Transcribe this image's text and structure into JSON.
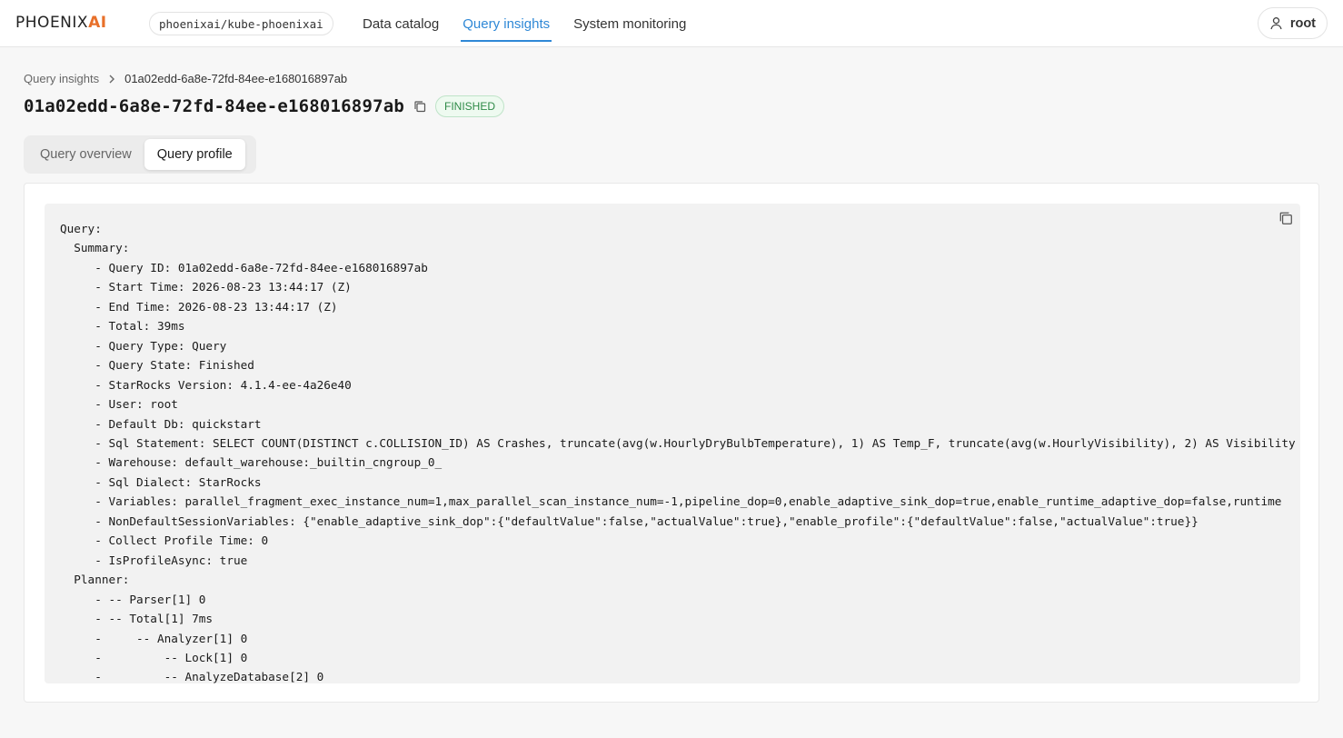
{
  "brand": {
    "logo_main": "PH",
    "logo_o": "O",
    "logo_rest": "ENI",
    "logo_x": "X",
    "logo_ai": "AI"
  },
  "cluster": "phoenixai/kube-phoenixai",
  "nav": {
    "items": [
      {
        "label": "Data catalog"
      },
      {
        "label": "Query insights"
      },
      {
        "label": "System monitoring"
      }
    ],
    "active": "Query insights"
  },
  "user": {
    "name": "root",
    "icon": "user-icon"
  },
  "breadcrumb": {
    "parent": "Query insights",
    "current": "01a02edd-6a8e-72fd-84ee-e168016897ab"
  },
  "title": "01a02edd-6a8e-72fd-84ee-e168016897ab",
  "status": {
    "label": "FINISHED",
    "color": "#2e8a47"
  },
  "tabs": [
    {
      "label": "Query overview"
    },
    {
      "label": "Query profile"
    }
  ],
  "active_tab": "Query profile",
  "profile_lines": [
    "Query:",
    "  Summary:",
    "     - Query ID: 01a02edd-6a8e-72fd-84ee-e168016897ab",
    "     - Start Time: 2026-08-23 13:44:17 (Z)",
    "     - End Time: 2026-08-23 13:44:17 (Z)",
    "     - Total: 39ms",
    "     - Query Type: Query",
    "     - Query State: Finished",
    "     - StarRocks Version: 4.1.4-ee-4a26e40",
    "     - User: root",
    "     - Default Db: quickstart",
    "     - Sql Statement: SELECT COUNT(DISTINCT c.COLLISION_ID) AS Crashes, truncate(avg(w.HourlyDryBulbTemperature), 1) AS Temp_F, truncate(avg(w.HourlyVisibility), 2) AS Visibility",
    "     - Warehouse: default_warehouse:_builtin_cngroup_0_",
    "     - Sql Dialect: StarRocks",
    "     - Variables: parallel_fragment_exec_instance_num=1,max_parallel_scan_instance_num=-1,pipeline_dop=0,enable_adaptive_sink_dop=true,enable_runtime_adaptive_dop=false,runtime",
    "     - NonDefaultSessionVariables: {\"enable_adaptive_sink_dop\":{\"defaultValue\":false,\"actualValue\":true},\"enable_profile\":{\"defaultValue\":false,\"actualValue\":true}}",
    "     - Collect Profile Time: 0",
    "     - IsProfileAsync: true",
    "  Planner:",
    "     - -- Parser[1] 0",
    "     - -- Total[1] 7ms",
    "     -     -- Analyzer[1] 0",
    "     -         -- Lock[1] 0",
    "     -         -- AnalyzeDatabase[2] 0"
  ],
  "accent_color": "#2f88d6"
}
